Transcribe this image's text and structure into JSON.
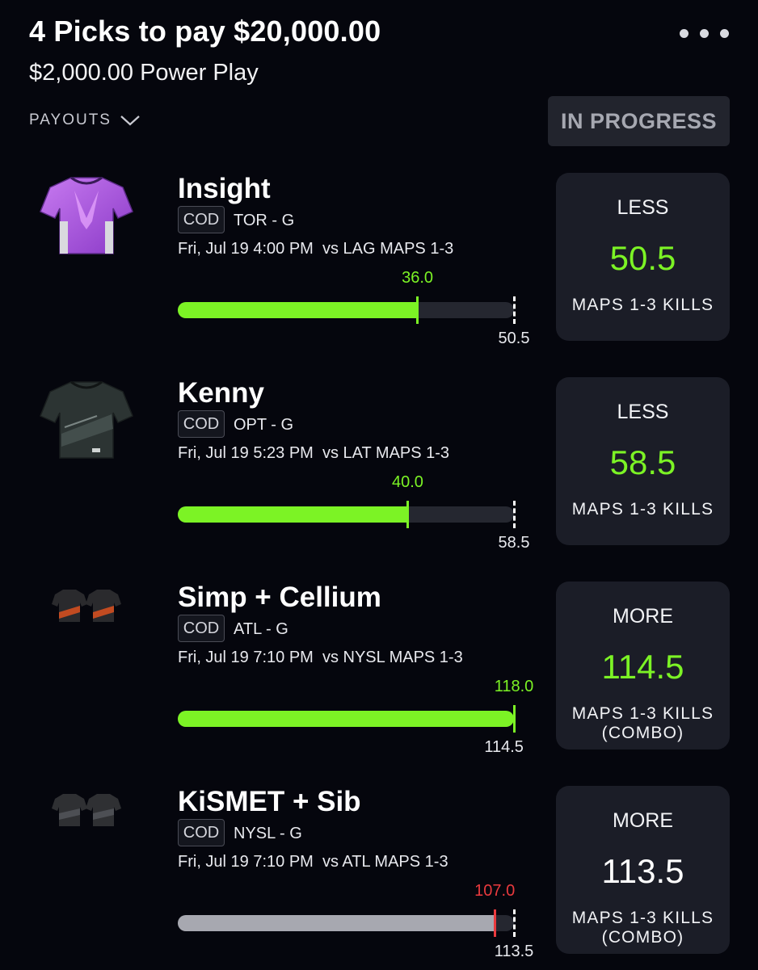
{
  "header": {
    "title": "4 Picks to pay $20,000.00",
    "subtitle": "$2,000.00 Power Play",
    "payouts_label": "PAYOUTS",
    "status_label": "IN PROGRESS"
  },
  "colors": {
    "hit": "#7cf325",
    "miss": "#ea3a3e",
    "miss_bar": "#a7a8b0"
  },
  "picks": [
    {
      "name": "Insight",
      "league": "COD",
      "team": "TOR - G",
      "when": "Fri, Jul 19 4:00 PM  vs LAG MAPS 1-3",
      "current": "36.0",
      "current_value": 36.0,
      "target": "50.5",
      "target_value": 50.5,
      "direction": "LESS",
      "line": "50.5",
      "stat": "MAPS 1-3 KILLS",
      "status": "hit",
      "jersey": "purple-jersey-icon"
    },
    {
      "name": "Kenny",
      "league": "COD",
      "team": "OPT - G",
      "when": "Fri, Jul 19 5:23 PM  vs LAT MAPS 1-3",
      "current": "40.0",
      "current_value": 40.0,
      "target": "58.5",
      "target_value": 58.5,
      "direction": "LESS",
      "line": "58.5",
      "stat": "MAPS 1-3 KILLS",
      "status": "hit",
      "jersey": "dark-jersey-icon"
    },
    {
      "name": "Simp + Cellium",
      "league": "COD",
      "team": "ATL - G",
      "when": "Fri, Jul 19 7:10 PM  vs NYSL MAPS 1-3",
      "current": "118.0",
      "current_value": 118.0,
      "target": "114.5",
      "target_value": 114.5,
      "direction": "MORE",
      "line": "114.5",
      "stat": "MAPS 1-3 KILLS",
      "stat2": "(COMBO)",
      "status": "hit",
      "jersey": "two-jerseys-icon"
    },
    {
      "name": "KiSMET + Sib",
      "league": "COD",
      "team": "NYSL - G",
      "when": "Fri, Jul 19 7:10 PM  vs ATL MAPS 1-3",
      "current": "107.0",
      "current_value": 107.0,
      "target": "113.5",
      "target_value": 113.5,
      "direction": "MORE",
      "line": "113.5",
      "stat": "MAPS 1-3 KILLS",
      "stat2": "(COMBO)",
      "status": "pending",
      "jersey": "two-jerseys-icon"
    }
  ]
}
